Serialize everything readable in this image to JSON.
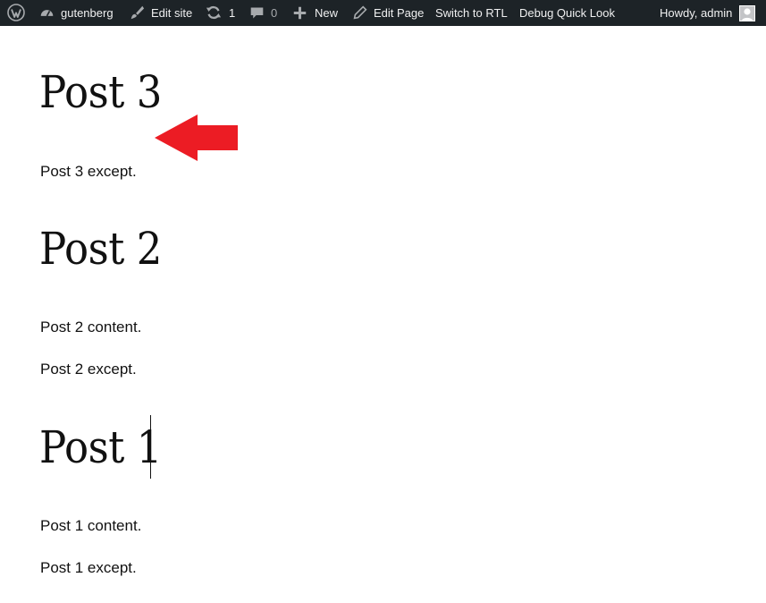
{
  "admin_bar": {
    "site_name": "gutenberg",
    "edit_site": "Edit site",
    "updates_count": "1",
    "comments_count": "0",
    "new_label": "New",
    "edit_page": "Edit Page",
    "switch_rtl": "Switch to RTL",
    "debug_quick_look": "Debug Quick Look",
    "howdy": "Howdy, admin"
  },
  "posts": [
    {
      "title": "Post 3",
      "content": "",
      "excerpt": "Post 3 except."
    },
    {
      "title": "Post 2",
      "content": "Post 2 content.",
      "excerpt": "Post 2 except."
    },
    {
      "title": "Post 1",
      "content": "Post 1 content.",
      "excerpt": "Post 1 except."
    }
  ],
  "colors": {
    "admin_bar_bg": "#1d2327",
    "admin_bar_text": "#f0f0f1",
    "arrow": "#ec1c24"
  },
  "icons": {
    "wordpress": "wordpress-logo-icon",
    "site": "dashboard-icon",
    "edit_site": "brush-icon",
    "updates": "refresh-icon",
    "comments": "comment-bubble-icon",
    "new": "plus-icon",
    "edit_page": "pencil-icon",
    "avatar": "avatar-icon"
  }
}
